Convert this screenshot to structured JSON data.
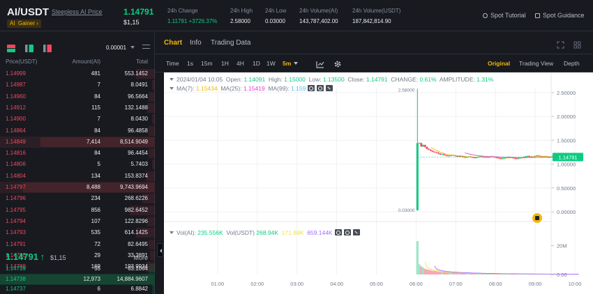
{
  "header": {
    "pair": "AI/USDT",
    "pair_link": "Sleepless AI Price",
    "tag": "AI",
    "tag_badge": "Gainer ›",
    "last_price": "1.14791",
    "last_price_usd": "$1,15",
    "stats": [
      {
        "label": "24h Change",
        "value": "1.11791 +3726.37%",
        "positive": true
      },
      {
        "label": "24h High",
        "value": "2.58000"
      },
      {
        "label": "24h Low",
        "value": "0.03000"
      },
      {
        "label": "24h Volume(AI)",
        "value": "143,787,402.00"
      },
      {
        "label": "24h Volume(USDT)",
        "value": "187,842,814.90"
      }
    ],
    "spot_tutorial": "Spot Tutorial",
    "spot_guidance": "Spot Guidance"
  },
  "orderbook": {
    "tick": "0.00001",
    "headers": {
      "price": "Price(USDT)",
      "amount": "Amount(AI)",
      "total": "Total"
    },
    "asks": [
      {
        "price": "1.14999",
        "amount": "481",
        "total": "553.1452",
        "depth": 0.12
      },
      {
        "price": "1.14987",
        "amount": "7",
        "total": "8.0491",
        "depth": 0.02
      },
      {
        "price": "1.14960",
        "amount": "84",
        "total": "96.5664",
        "depth": 0.04
      },
      {
        "price": "1.14912",
        "amount": "115",
        "total": "132.1488",
        "depth": 0.05
      },
      {
        "price": "1.14900",
        "amount": "7",
        "total": "8.0430",
        "depth": 0.02
      },
      {
        "price": "1.14864",
        "amount": "84",
        "total": "96.4858",
        "depth": 0.04
      },
      {
        "price": "1.14849",
        "amount": "7,414",
        "total": "8,514.9049",
        "depth": 0.74,
        "highlight": true
      },
      {
        "price": "1.14816",
        "amount": "84",
        "total": "96.4454",
        "depth": 0.04
      },
      {
        "price": "1.14806",
        "amount": "5",
        "total": "5.7403",
        "depth": 0.02
      },
      {
        "price": "1.14804",
        "amount": "134",
        "total": "153.8374",
        "depth": 0.06
      },
      {
        "price": "1.14797",
        "amount": "8,488",
        "total": "9,743.9694",
        "depth": 0.85,
        "highlight": true
      },
      {
        "price": "1.14796",
        "amount": "234",
        "total": "268.6226",
        "depth": 0.08
      },
      {
        "price": "1.14795",
        "amount": "856",
        "total": "982.6452",
        "depth": 0.16
      },
      {
        "price": "1.14794",
        "amount": "107",
        "total": "122.8296",
        "depth": 0.05
      },
      {
        "price": "1.14793",
        "amount": "535",
        "total": "614.1425",
        "depth": 0.12
      },
      {
        "price": "1.14791",
        "amount": "72",
        "total": "82.6495",
        "depth": 0.04
      },
      {
        "price": "1.14790",
        "amount": "29",
        "total": "33.2891",
        "depth": 0.03
      },
      {
        "price": "1.14789",
        "amount": "169",
        "total": "193.9934",
        "depth": 0.06
      }
    ],
    "mid_price": "1.14791",
    "mid_arrow": "↑",
    "mid_usd": "$1,15",
    "more": "More",
    "bids": [
      {
        "price": "1.14739",
        "amount": "55",
        "total": "63.1064",
        "depth": 0.04
      },
      {
        "price": "1.14738",
        "amount": "12,973",
        "total": "14,884.9607",
        "depth": 1.0,
        "highlight": true
      },
      {
        "price": "1.14737",
        "amount": "6",
        "total": "6.8842",
        "depth": 0.02
      }
    ]
  },
  "tabs": [
    "Chart",
    "Info",
    "Trading Data"
  ],
  "active_tab": "Chart",
  "timeframes": [
    "Time",
    "1s",
    "15m",
    "1H",
    "4H",
    "1D",
    "1W",
    "5m"
  ],
  "active_timeframe": "5m",
  "views": [
    "Original",
    "Trading View",
    "Depth"
  ],
  "active_view": "Original",
  "legend": {
    "date": "2024/01/04 10:05",
    "open_label": "Open:",
    "open": "1.14091",
    "high_label": "High:",
    "high": "1.15000",
    "low_label": "Low:",
    "low": "1.13500",
    "close_label": "Close:",
    "close": "1.14791",
    "change_label": "CHANGE:",
    "change": "0.61%",
    "amp_label": "AMPLITUDE:",
    "amp": "1.31%",
    "ma7_label": "MA(7):",
    "ma7": "1.15434",
    "ma25_label": "MA(25):",
    "ma25": "1.15419",
    "ma99_label": "MA(99):",
    "ma99": "1.159",
    "vol_ai_label": "Vol(AI):",
    "vol_ai": "235.556K",
    "vol_usdt_label": "Vol(USDT)",
    "vol_usdt": "268.94K",
    "vol_ma5": "171.88K",
    "vol_ma10": "659.144K"
  },
  "chart_data": {
    "type": "candlestick",
    "interval": "5m",
    "price_axis": {
      "ticks": [
        "2.50000",
        "2.00000",
        "1.50000",
        "1.00000",
        "0.50000",
        "0.00000"
      ],
      "ylim": [
        0,
        2.6
      ]
    },
    "volume_axis": {
      "ticks": [
        "20M",
        "0.00"
      ]
    },
    "x_ticks": [
      "01:00",
      "02:00",
      "03:00",
      "04:00",
      "05:00",
      "06:00",
      "07:00",
      "08:00",
      "09:00",
      "10:00"
    ],
    "high_label": "2.58000",
    "low_label": "0.03000",
    "current_price_label": "1.14791",
    "colors": {
      "up": "#0ecb81",
      "down": "#f6465d",
      "ma7": "#f0b90b",
      "ma25": "#e541d4",
      "ma99": "#53c1e8"
    },
    "first_candle": {
      "time": "06:00",
      "open": 0.03,
      "high": 2.58,
      "low": 0.03,
      "close": 1.44
    },
    "closes": [
      1.44,
      1.37,
      1.4,
      1.36,
      1.32,
      1.3,
      1.28,
      1.26,
      1.25,
      1.24,
      1.22,
      1.2,
      1.21,
      1.19,
      1.18,
      1.17,
      1.18,
      1.19,
      1.18,
      1.17,
      1.16,
      1.17,
      1.16,
      1.15,
      1.14,
      1.15,
      1.16,
      1.15,
      1.14,
      1.13,
      1.14,
      1.15,
      1.16,
      1.15,
      1.14,
      1.15,
      1.14,
      1.15,
      1.16,
      1.15,
      1.14,
      1.13,
      1.12,
      1.11,
      1.12,
      1.13,
      1.14,
      1.15,
      1.14,
      1.13,
      1.12,
      1.11,
      1.12,
      1.13,
      1.14,
      1.15,
      1.16,
      1.17,
      1.16,
      1.15,
      1.16,
      1.17,
      1.18,
      1.17,
      1.16,
      1.15,
      1.16,
      1.15,
      1.14,
      1.15,
      1.16,
      1.15,
      1.14,
      1.15,
      1.14,
      1.15,
      1.15,
      1.14,
      1.15,
      1.15,
      1.14,
      1.15,
      1.14,
      1.13,
      1.14,
      1.15
    ],
    "volumes_m": [
      23.0,
      7.0,
      5.5,
      4.8,
      3.9,
      3.5,
      3.2,
      2.9,
      2.6,
      2.4,
      2.2,
      2.0,
      1.9,
      1.8,
      1.7,
      1.6,
      1.5,
      1.5,
      1.4,
      1.3,
      1.3,
      1.2,
      1.2,
      1.1,
      1.1,
      1.0,
      1.0,
      0.95,
      0.9,
      0.9,
      0.85,
      0.8,
      0.8,
      0.75,
      0.7,
      0.7,
      0.7,
      0.65,
      0.6,
      0.6,
      0.6,
      0.55,
      0.55,
      0.5,
      0.5,
      0.5,
      0.5,
      0.45,
      0.45,
      0.45,
      0.4,
      0.4,
      0.4,
      0.4,
      0.4,
      0.38,
      0.36,
      0.36,
      0.35,
      0.35,
      0.34,
      0.33,
      0.33,
      0.32,
      0.31,
      0.3,
      0.3,
      0.3,
      0.29,
      0.28,
      0.28,
      0.27,
      0.27,
      0.26,
      0.26,
      0.25,
      0.25,
      0.24,
      0.24,
      0.24,
      0.24,
      0.23,
      0.23,
      0.22,
      0.22,
      0.22
    ]
  }
}
